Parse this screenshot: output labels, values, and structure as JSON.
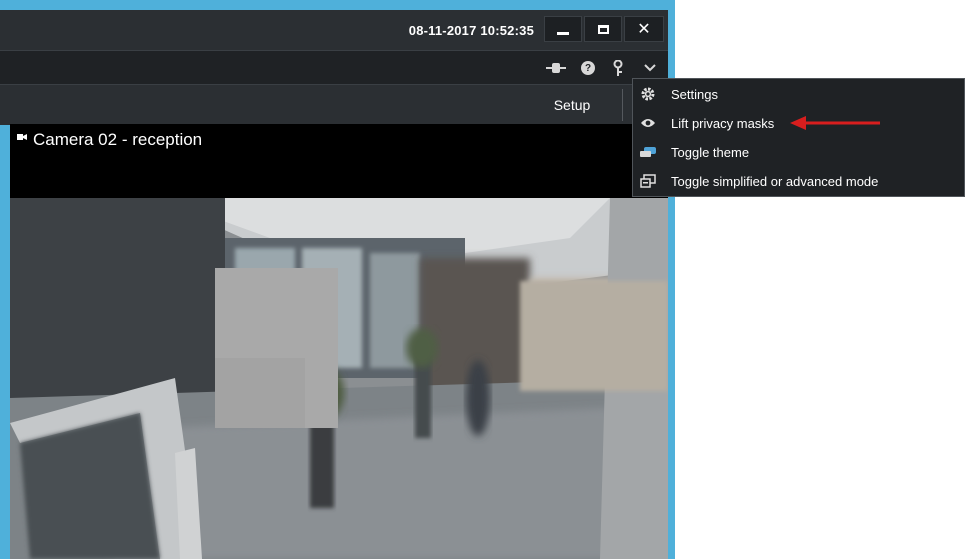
{
  "titlebar": {
    "datetime": "08-11-2017 10:52:35",
    "close_glyph": "✕"
  },
  "toolbar": {
    "connect_icon": "connection-icon",
    "help_glyph": "?",
    "key_glyph": "🔑",
    "chevron_glyph": "⌄"
  },
  "tabs": {
    "setup_label": "Setup"
  },
  "camera": {
    "title": "Camera 02 - reception"
  },
  "menu": {
    "items": [
      {
        "label": "Settings",
        "icon": "gear-icon"
      },
      {
        "label": "Lift privacy masks",
        "icon": "eye-icon"
      },
      {
        "label": "Toggle theme",
        "icon": "theme-icon"
      },
      {
        "label": "Toggle simplified or advanced mode",
        "icon": "mode-icon"
      }
    ]
  },
  "colors": {
    "window_border": "#4fb0da",
    "titlebar": "#2b2f33",
    "menu_bg": "#1f2225",
    "arrow": "#d81e1e",
    "privacy_mask": "#a9a9a9"
  }
}
